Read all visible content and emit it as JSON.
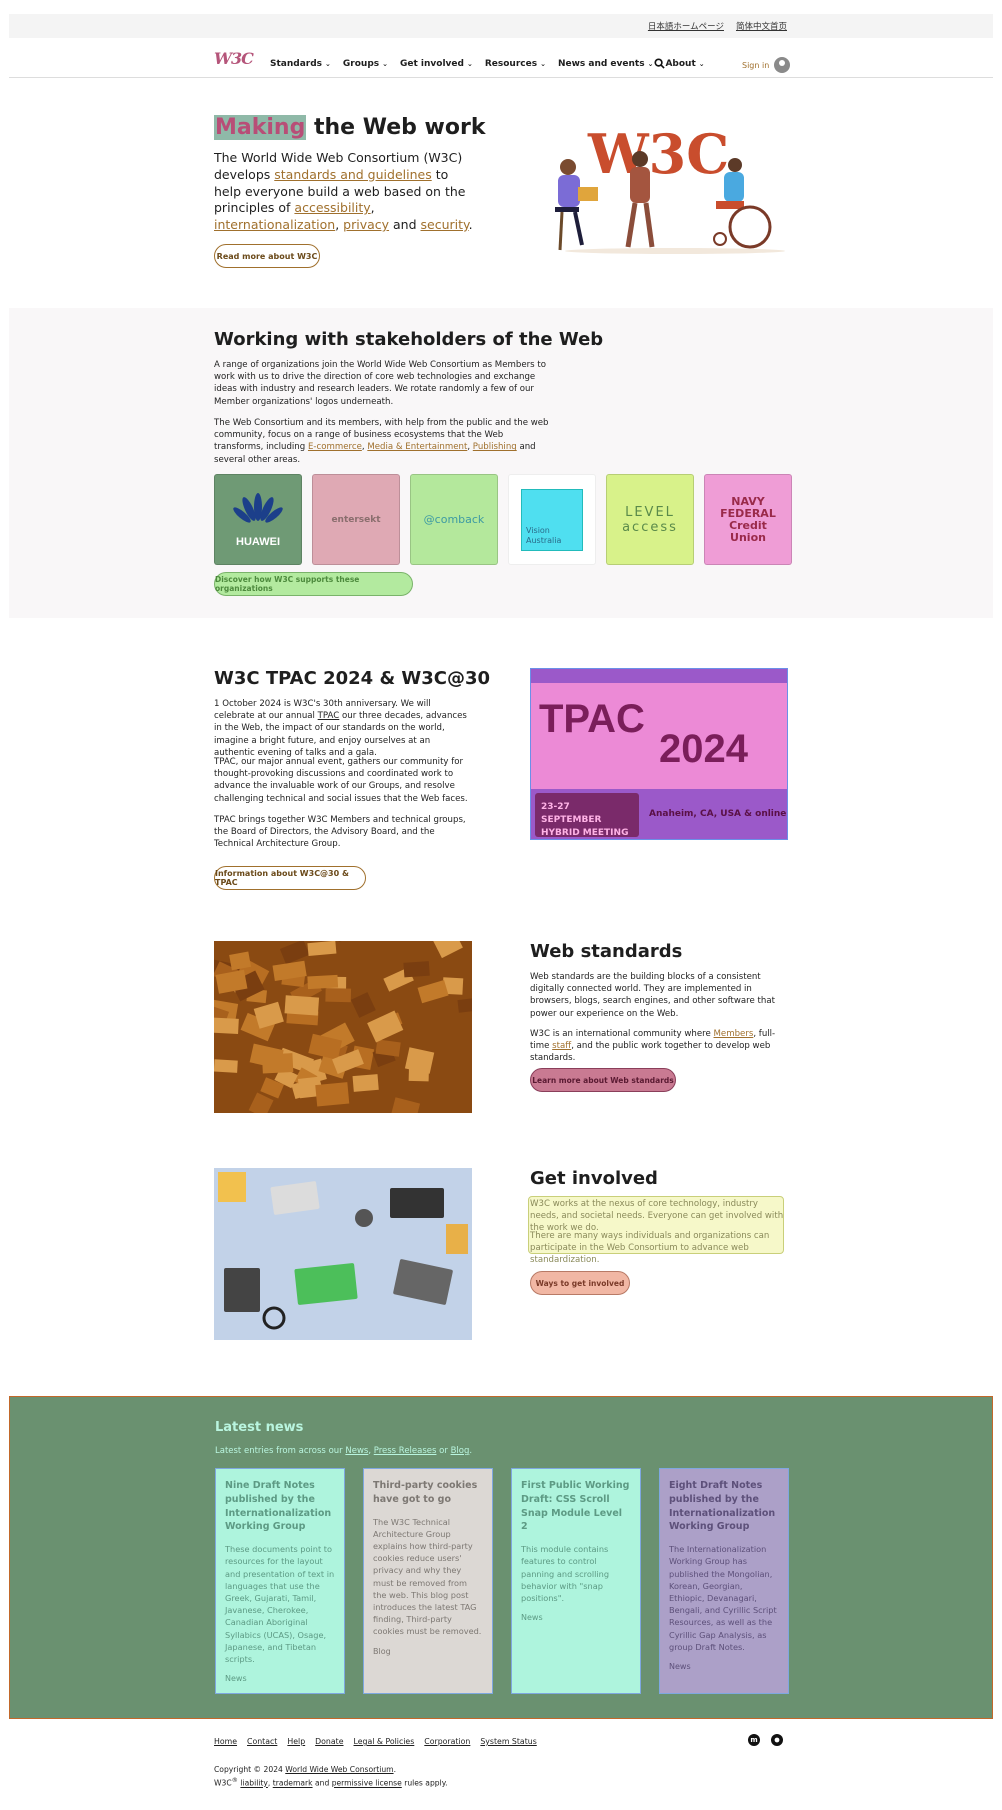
{
  "utility": {
    "japanese_link": "日本語ホームページ",
    "chinese_link": "简体中文首页"
  },
  "nav": {
    "logo": "W3C",
    "items": [
      {
        "label": "Standards"
      },
      {
        "label": "Groups"
      },
      {
        "label": "Get involved"
      },
      {
        "label": "Resources"
      },
      {
        "label": "News and events"
      },
      {
        "label": "About"
      }
    ],
    "signin": "Sign in"
  },
  "hero": {
    "title_highlight": "Making",
    "title_rest": " the Web work",
    "text_1": "The World Wide Web Consortium (W3C) develops ",
    "link_standards": "standards and guidelines",
    "text_2": " to help everyone build a web based on the principles of ",
    "link_accessibility": "accessibility",
    "sep1": ", ",
    "link_i18n": "internationalization",
    "sep2": ", ",
    "link_privacy": "privacy",
    "text_3": " and ",
    "link_security": "security",
    "text_4": ".",
    "button": "Read more about W3C",
    "image_text": "W3C"
  },
  "stakeholders": {
    "title": "Working with stakeholders of the Web",
    "para1": "A range of organizations join the World Wide Web Consortium as Members to work with us to drive the direction of core web technologies and exchange ideas with industry and research leaders. We rotate randomly a few of our Member organizations' logos underneath.",
    "para2_a": "The Web Consortium and its members, with help from the public and the web community, focus on a range of business ecosystems that the Web transforms, including ",
    "link_ecommerce": "E-commerce",
    "sep1": ", ",
    "link_media": "Media & Entertainment",
    "sep2": ", ",
    "link_publishing": "Publishing",
    "para2_b": " and several other areas.",
    "logos": [
      {
        "name": "HUAWEI",
        "bg": "#6f9a75"
      },
      {
        "name": "entersekt",
        "bg": "#dfa9b4"
      },
      {
        "name": "@comback",
        "bg": "#b4e89c"
      },
      {
        "name": "Vision Australia",
        "bg": "#ffffff"
      },
      {
        "name": "LEVEL access",
        "bg": "#d8f28a"
      },
      {
        "name": "NAVY FEDERAL Credit Union",
        "bg": "#ef9dd6"
      }
    ],
    "button": "Discover how W3C supports these organizations"
  },
  "tpac": {
    "title": "W3C TPAC 2024 & W3C@30",
    "p1_a": "1 October 2024 is W3C's 30th anniversary. We will celebrate at our annual ",
    "p1_link": "TPAC",
    "p1_b": " our three decades, advances in the Web, the impact of our standards on the world, imagine a bright future, and enjoy ourselves at an authentic evening of talks and a gala.",
    "p2": "TPAC, our major annual event, gathers our community for thought-provoking discussions and coordinated work to advance the invaluable work of our Groups, and resolve challenging technical and social issues that the Web faces.",
    "p3": "TPAC brings together W3C Members and technical groups, the Board of Directors, the Advisory Board, and the Technical Architecture Group.",
    "button": "Information about W3C@30 & TPAC",
    "banner_title_1": "TPAC",
    "banner_title_2": "2024",
    "banner_dates_1": "23-27 SEPTEMBER",
    "banner_dates_2": "HYBRID MEETING",
    "banner_location": "Anaheim, CA, USA & online"
  },
  "standards": {
    "title": "Web standards",
    "p1": "Web standards are the building blocks of a consistent digitally connected world. They are implemented in browsers, blogs, search engines, and other software that power our experience on the Web.",
    "p2_a": "W3C is an international community where ",
    "link_members": "Members",
    "p2_b": ", full-time ",
    "link_staff": "staff",
    "p2_c": ", and the public work together to develop web standards.",
    "button": "Learn more about Web standards"
  },
  "involved": {
    "title": "Get involved",
    "p1": "W3C works at the nexus of core technology, industry needs, and societal needs. Everyone can get involved with the work we do.",
    "p2": "There are many ways individuals and organizations can participate in the Web Consortium to advance web standardization.",
    "button": "Ways to get involved"
  },
  "news": {
    "title": "Latest news",
    "sub_a": "Latest entries from across our ",
    "link_news": "News",
    "sub_sep": ", ",
    "link_press": "Press Releases",
    "sub_or": " or ",
    "link_blog": "Blog",
    "sub_end": ".",
    "cards": [
      {
        "title": "Nine Draft Notes published by the Internationalization Working Group",
        "body": "These documents point to resources for the layout and presentation of text in languages that use the Greek, Gujarati, Tamil, Javanese, Cherokee, Canadian Aboriginal Syllabics (UCAS), Osage, Japanese, and Tibetan scripts.",
        "tag": "News",
        "bg": "#aef4dd",
        "fg": "#5d9a84"
      },
      {
        "title": "Third-party cookies have got to go",
        "body": "The W3C Technical Architecture Group explains how third-party cookies reduce users' privacy and why they must be removed from the web. This blog post introduces the latest TAG finding, Third-party cookies must be removed.",
        "tag": "Blog",
        "bg": "#dcd8d4",
        "fg": "#7d7873"
      },
      {
        "title": "First Public Working Draft: CSS Scroll Snap Module Level 2",
        "body": "This module contains features to control panning and scrolling behavior with \"snap positions\".",
        "tag": "News",
        "bg": "#aef4dd",
        "fg": "#5d9a84"
      },
      {
        "title": "Eight Draft Notes published by the Internationalization Working Group",
        "body": "The Internationalization Working Group has published the Mongolian, Korean, Georgian, Ethiopic, Devanagari, Bengali, and Cyrillic Script Resources, as well as the Cyrillic Gap Analysis, as group Draft Notes.",
        "tag": "News",
        "bg": "#aca0c8",
        "fg": "#5d507a"
      }
    ]
  },
  "footer": {
    "links": [
      "Home",
      "Contact",
      "Help",
      "Donate",
      "Legal & Policies",
      "Corporation",
      "System Status"
    ],
    "copy_a": "Copyright © 2024 ",
    "copy_link": "World Wide Web Consortium",
    "copy_end": ".",
    "line2_a": "W3C",
    "line2_sup": "®",
    "line2_liability": "liability",
    "line2_sep": ", ",
    "line2_trademark": "trademark",
    "line2_and": " and ",
    "line2_license": "permissive license",
    "line2_end": " rules apply.",
    "mastodon_icon": "mastodon-icon",
    "github_icon": "github-icon"
  }
}
